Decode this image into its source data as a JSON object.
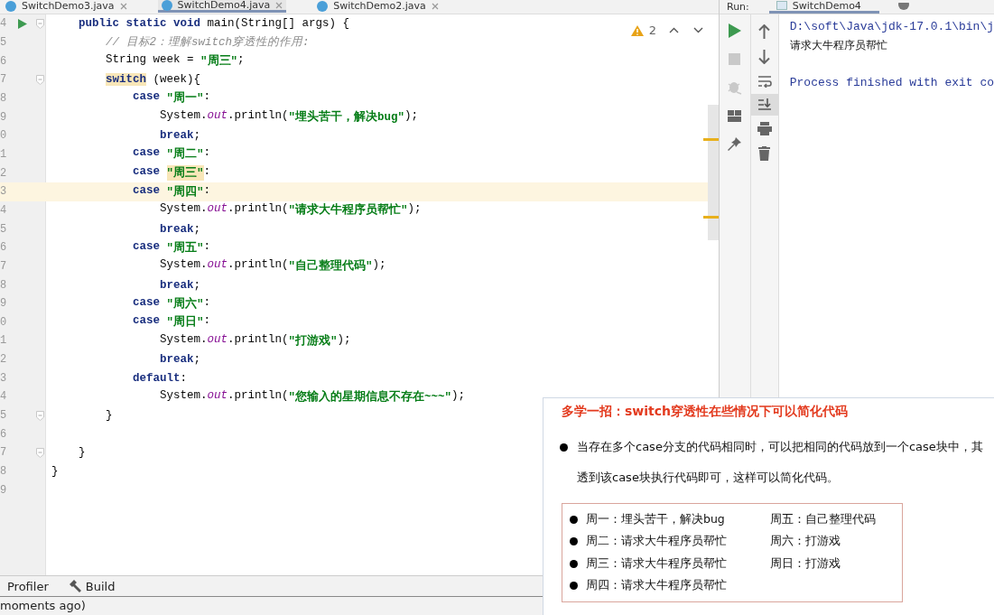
{
  "editor_tabs": [
    {
      "label": "SwitchDemo3.java",
      "selected": false
    },
    {
      "label": "SwitchDemo4.java",
      "selected": true
    },
    {
      "label": "SwitchDemo2.java",
      "selected": false
    }
  ],
  "editor": {
    "warning_count": "2",
    "lines": [
      {
        "children": [
          {
            "n": "4",
            "run": true,
            "fold": true,
            "current": false,
            "tokens": [
              {
                "t": "public static void",
                "kind": "kw"
              },
              {
                "t": " main(String[] args) {",
                "kind": "plain"
              }
            ],
            "children": [
              {
                "n": "5",
                "run": false,
                "fold": false,
                "current": false,
                "tokens": [
                  {
                    "t": "// 目标2：理解switch穿透性的作用:",
                    "kind": "comment"
                  }
                ]
              },
              {
                "n": "6",
                "run": false,
                "fold": false,
                "current": false,
                "tokens": [
                  {
                    "t": "String week = ",
                    "kind": "plain"
                  },
                  {
                    "t": "\"周三\"",
                    "kind": "str"
                  },
                  {
                    "t": ";",
                    "kind": "plain"
                  }
                ]
              },
              {
                "n": "7",
                "run": false,
                "fold": true,
                "current": false,
                "tokens": [
                  {
                    "t": "switch",
                    "kind": "kwmatch"
                  },
                  {
                    "t": " (week){",
                    "kind": "plain"
                  }
                ],
                "children": [
                  {
                    "n": "8",
                    "run": false,
                    "fold": false,
                    "current": false,
                    "tokens": [
                      {
                        "t": "case ",
                        "kind": "kw"
                      },
                      {
                        "t": "\"周一\"",
                        "kind": "str"
                      },
                      {
                        "t": ":",
                        "kind": "plain"
                      }
                    ],
                    "children": [
                      {
                        "n": "9",
                        "run": false,
                        "fold": false,
                        "current": false,
                        "tokens": [
                          {
                            "t": "System.",
                            "kind": "plain"
                          },
                          {
                            "t": "out",
                            "kind": "field"
                          },
                          {
                            "t": ".println(",
                            "kind": "plain"
                          },
                          {
                            "t": "\"埋头苦干，解决bug\"",
                            "kind": "str"
                          },
                          {
                            "t": ");",
                            "kind": "plain"
                          }
                        ]
                      },
                      {
                        "n": "0",
                        "run": false,
                        "fold": false,
                        "current": false,
                        "tokens": [
                          {
                            "t": "break",
                            "kind": "kw"
                          },
                          {
                            "t": ";",
                            "kind": "plain"
                          }
                        ]
                      }
                    ]
                  },
                  {
                    "n": "1",
                    "run": false,
                    "fold": false,
                    "current": false,
                    "tokens": [
                      {
                        "t": "case ",
                        "kind": "kw"
                      },
                      {
                        "t": "\"周二\"",
                        "kind": "str"
                      },
                      {
                        "t": ":",
                        "kind": "plain"
                      }
                    ]
                  },
                  {
                    "n": "2",
                    "run": false,
                    "fold": false,
                    "current": false,
                    "tokens": [
                      {
                        "t": "case ",
                        "kind": "kw"
                      },
                      {
                        "t": "\"周三\"",
                        "kind": "strmatch"
                      },
                      {
                        "t": ":",
                        "kind": "plain"
                      }
                    ]
                  },
                  {
                    "n": "3",
                    "run": false,
                    "fold": false,
                    "current": true,
                    "tokens": [
                      {
                        "t": "case ",
                        "kind": "kw"
                      },
                      {
                        "t": "\"周四\"",
                        "kind": "str"
                      },
                      {
                        "t": ":",
                        "kind": "plain"
                      }
                    ],
                    "children": [
                      {
                        "n": "4",
                        "run": false,
                        "fold": false,
                        "current": false,
                        "tokens": [
                          {
                            "t": "System.",
                            "kind": "plain"
                          },
                          {
                            "t": "out",
                            "kind": "field"
                          },
                          {
                            "t": ".println(",
                            "kind": "plain"
                          },
                          {
                            "t": "\"请求大牛程序员帮忙\"",
                            "kind": "str"
                          },
                          {
                            "t": ");",
                            "kind": "plain"
                          }
                        ]
                      },
                      {
                        "n": "5",
                        "run": false,
                        "fold": false,
                        "current": false,
                        "tokens": [
                          {
                            "t": "break",
                            "kind": "kw"
                          },
                          {
                            "t": ";",
                            "kind": "plain"
                          }
                        ]
                      }
                    ]
                  },
                  {
                    "n": "6",
                    "run": false,
                    "fold": false,
                    "current": false,
                    "tokens": [
                      {
                        "t": "case ",
                        "kind": "kw"
                      },
                      {
                        "t": "\"周五\"",
                        "kind": "str"
                      },
                      {
                        "t": ":",
                        "kind": "plain"
                      }
                    ],
                    "children": [
                      {
                        "n": "7",
                        "run": false,
                        "fold": false,
                        "current": false,
                        "tokens": [
                          {
                            "t": "System.",
                            "kind": "plain"
                          },
                          {
                            "t": "out",
                            "kind": "field"
                          },
                          {
                            "t": ".println(",
                            "kind": "plain"
                          },
                          {
                            "t": "\"自己整理代码\"",
                            "kind": "str"
                          },
                          {
                            "t": ");",
                            "kind": "plain"
                          }
                        ]
                      },
                      {
                        "n": "8",
                        "run": false,
                        "fold": false,
                        "current": false,
                        "tokens": [
                          {
                            "t": "break",
                            "kind": "kw"
                          },
                          {
                            "t": ";",
                            "kind": "plain"
                          }
                        ]
                      }
                    ]
                  },
                  {
                    "n": "9",
                    "run": false,
                    "fold": false,
                    "current": false,
                    "tokens": [
                      {
                        "t": "case ",
                        "kind": "kw"
                      },
                      {
                        "t": "\"周六\"",
                        "kind": "str"
                      },
                      {
                        "t": ":",
                        "kind": "plain"
                      }
                    ]
                  },
                  {
                    "n": "0",
                    "run": false,
                    "fold": false,
                    "current": false,
                    "tokens": [
                      {
                        "t": "case ",
                        "kind": "kw"
                      },
                      {
                        "t": "\"周日\"",
                        "kind": "str"
                      },
                      {
                        "t": ":",
                        "kind": "plain"
                      }
                    ],
                    "children": [
                      {
                        "n": "1",
                        "run": false,
                        "fold": false,
                        "current": false,
                        "tokens": [
                          {
                            "t": "System.",
                            "kind": "plain"
                          },
                          {
                            "t": "out",
                            "kind": "field"
                          },
                          {
                            "t": ".println(",
                            "kind": "plain"
                          },
                          {
                            "t": "\"打游戏\"",
                            "kind": "str"
                          },
                          {
                            "t": ");",
                            "kind": "plain"
                          }
                        ]
                      },
                      {
                        "n": "2",
                        "run": false,
                        "fold": false,
                        "current": false,
                        "tokens": [
                          {
                            "t": "break",
                            "kind": "kw"
                          },
                          {
                            "t": ";",
                            "kind": "plain"
                          }
                        ]
                      }
                    ]
                  },
                  {
                    "n": "3",
                    "run": false,
                    "fold": false,
                    "current": false,
                    "tokens": [
                      {
                        "t": "default",
                        "kind": "kw"
                      },
                      {
                        "t": ":",
                        "kind": "plain"
                      }
                    ],
                    "children": [
                      {
                        "n": "4",
                        "run": false,
                        "fold": false,
                        "current": false,
                        "tokens": [
                          {
                            "t": "System.",
                            "kind": "plain"
                          },
                          {
                            "t": "out",
                            "kind": "field"
                          },
                          {
                            "t": ".println(",
                            "kind": "plain"
                          },
                          {
                            "t": "\"您输入的星期信息不存在~~~\"",
                            "kind": "str"
                          },
                          {
                            "t": ");",
                            "kind": "plain"
                          }
                        ]
                      }
                    ]
                  }
                ]
              },
              {
                "n": "5",
                "run": false,
                "fold": true,
                "current": false,
                "tokens": [
                  {
                    "t": "}",
                    "kind": "plain"
                  }
                ]
              },
              {
                "n": "6",
                "run": false,
                "fold": false,
                "current": false
              }
            ]
          },
          {
            "n": "7",
            "run": false,
            "fold": true,
            "current": false,
            "tokens": [
              {
                "t": "}",
                "kind": "plain"
              }
            ]
          }
        ]
      },
      {
        "n": "8",
        "run": false,
        "fold": false,
        "current": false,
        "tokens": [
          {
            "t": "}",
            "kind": "plain"
          }
        ]
      },
      {
        "n": "9",
        "run": false,
        "fold": false,
        "current": false
      }
    ]
  },
  "run_panel": {
    "label": "Run:",
    "tab": "SwitchDemo4",
    "console": [
      {
        "t": "D:\\soft\\Java\\jdk-17.0.1\\bin\\j",
        "kind": "cmd"
      },
      {
        "t": "请求大牛程序员帮忙",
        "kind": "out"
      },
      {
        "t": "Process finished with exit co",
        "kind": "sys"
      }
    ]
  },
  "tool_strip": [
    "Profiler",
    "Build"
  ],
  "status_bar": "moments ago)",
  "slide": {
    "title": "多学一招：switch穿透性在些情况下可以简化代码",
    "bullet_lines": [
      "当存在多个case分支的代码相同时，可以把相同的代码放到一个case块中，其",
      "透到该case块执行代码即可，这样可以简化代码。"
    ],
    "left_items": [
      "周一：埋头苦干，解决bug",
      "周二：请求大牛程序员帮忙",
      "周三：请求大牛程序员帮忙",
      "周四：请求大牛程序员帮忙"
    ],
    "right_items": [
      "周五：自己整理代码",
      "周六：打游戏",
      "周日：打游戏"
    ]
  }
}
